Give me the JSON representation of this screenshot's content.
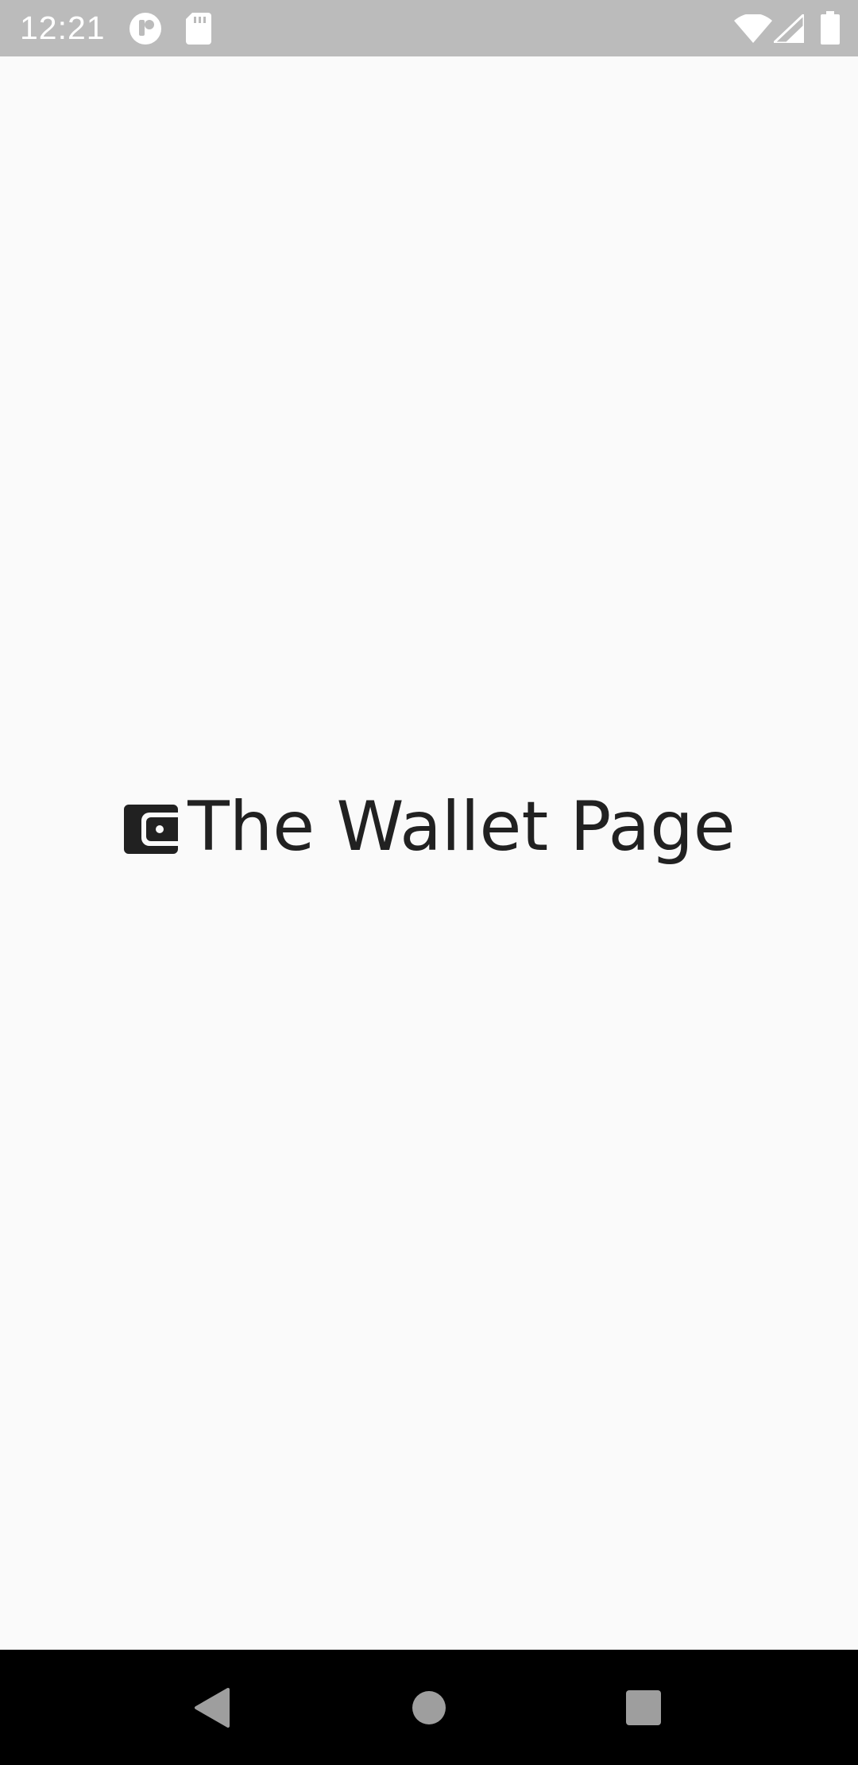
{
  "status_bar": {
    "time": "12:21",
    "background_color": "#bbbbbb",
    "icons_left": [
      "notification-app-icon",
      "sd-card-icon"
    ],
    "icons_right": [
      "wifi-icon",
      "cell-signal-icon",
      "battery-icon"
    ]
  },
  "splash": {
    "logo_icon": "wallet-icon",
    "title": "The Wallet Page",
    "text_color": "#212121"
  },
  "nav_bar": {
    "buttons": [
      "back",
      "home",
      "recents"
    ],
    "background_color": "#000000",
    "button_color": "#9e9e9e"
  }
}
